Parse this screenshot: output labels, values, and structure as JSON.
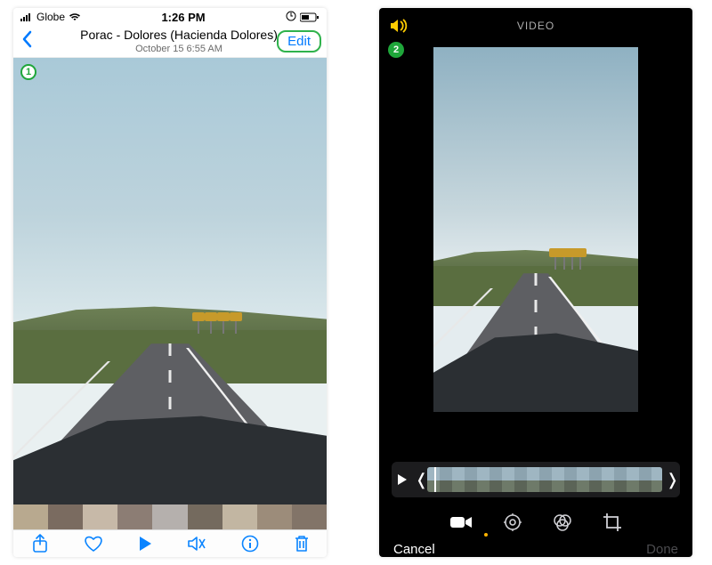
{
  "left": {
    "status": {
      "carrier": "Globe",
      "time": "1:26 PM"
    },
    "nav": {
      "title": "Porac - Dolores (Hacienda Dolores)",
      "subtitle": "October 15  6:55 AM",
      "edit": "Edit"
    },
    "icons": {
      "back": "back-chevron-icon",
      "share": "share-icon",
      "favorite": "heart-icon",
      "play": "play-icon",
      "mute": "mute-icon",
      "info": "info-icon",
      "delete": "trash-icon"
    },
    "step": "1"
  },
  "right": {
    "header": {
      "title": "VIDEO"
    },
    "scrubber": {
      "left_handle": "❬",
      "right_handle": "❭"
    },
    "actions": {
      "cancel": "Cancel",
      "done": "Done"
    },
    "tabs": {
      "video": "video-tab-icon",
      "adjust": "adjust-tab-icon",
      "filters": "filters-tab-icon",
      "crop": "crop-tab-icon"
    },
    "step": "2"
  }
}
